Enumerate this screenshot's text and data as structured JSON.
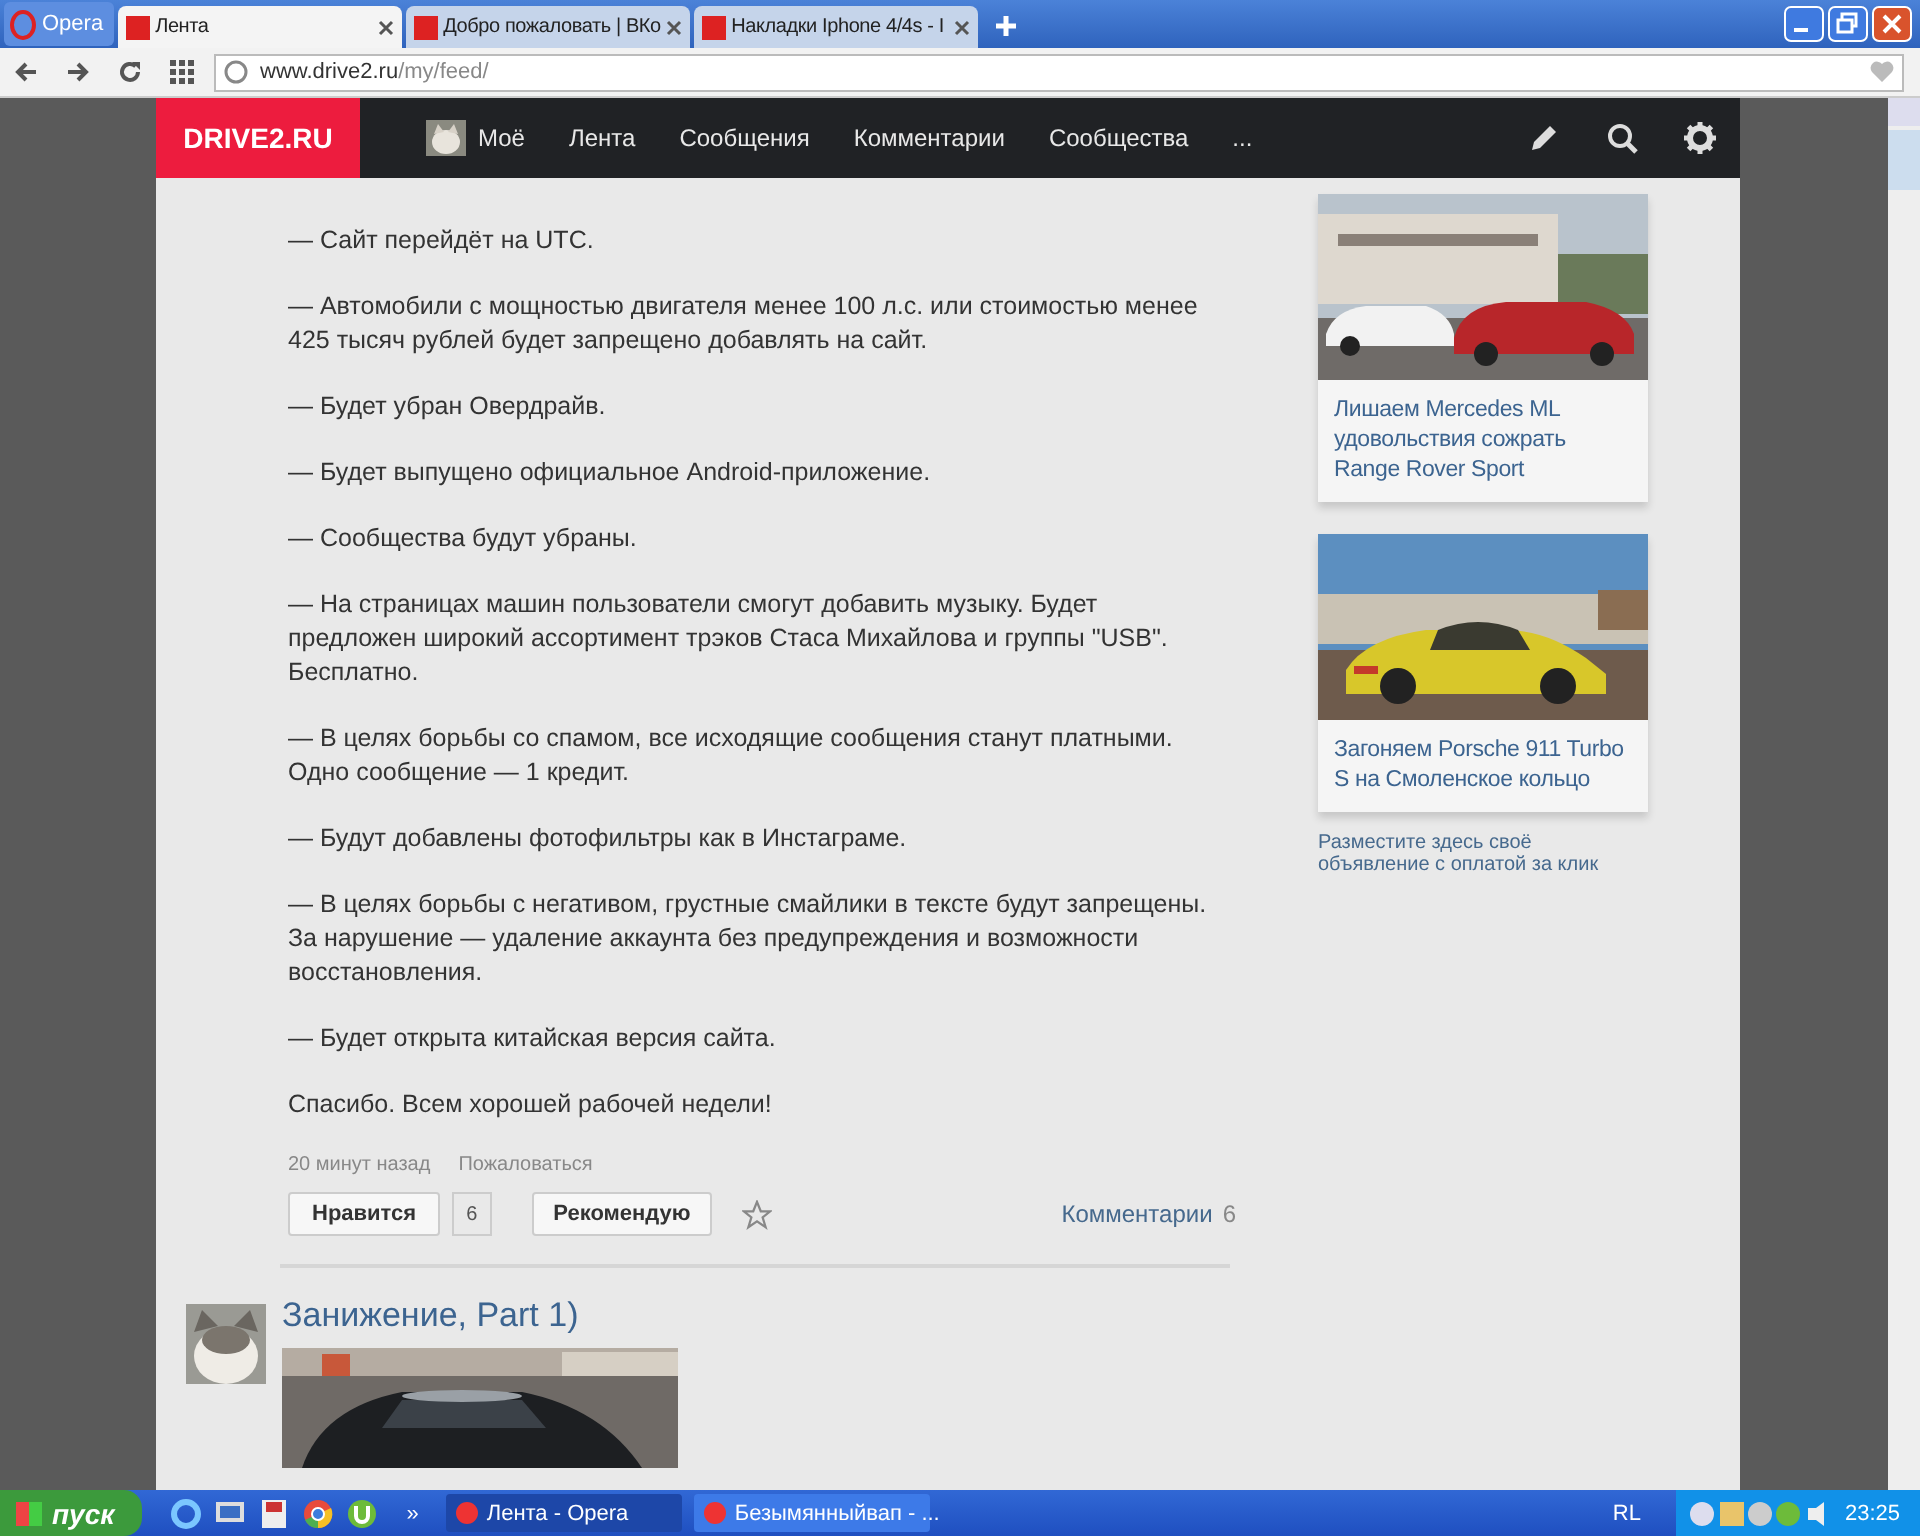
{
  "browser": {
    "menu_label": "Opera",
    "tabs": [
      {
        "title": "Лента",
        "selected": true
      },
      {
        "title": "Добро пожаловать | ВКо",
        "selected": false
      },
      {
        "title": "Накладки Iphone 4/4s - I",
        "selected": false
      }
    ],
    "address_host": "www.drive2.ru",
    "address_path": "/my/feed/"
  },
  "nav": {
    "logo": "DRIVE2.RU",
    "items": [
      {
        "label": "Моё",
        "kind": "avatar"
      },
      {
        "label": "Лента",
        "kind": "text"
      },
      {
        "label": "Сообщения",
        "kind": "text"
      },
      {
        "label": "Комментарии",
        "kind": "text"
      },
      {
        "label": "Сообщества",
        "kind": "text"
      },
      {
        "label": "...",
        "kind": "text"
      }
    ]
  },
  "post": {
    "paragraphs": [
      "— Сайт перейдёт на UTC.",
      "— Автомобили с мощностью двигателя менее 100 л.с. или стоимостью менее 425 тысяч рублей будет запрещено добавлять на сайт.",
      "— Будет убран Овердрайв.",
      "— Будет выпущено официальное Android-приложение.",
      "— Сообщества будут убраны.",
      "— На страницах машин пользователи смогут добавить музыку. Будет предложен широкий ассортимент трэков Стаса Михайлова и группы \"USB\". Бесплатно.",
      "— В целях борьбы со спамом, все исходящие сообщения станут платными. Одно сообщение — 1 кредит.",
      "— Будут добавлены фотофильтры как в Инстаграме.",
      "— В целях борьбы с негативом, грустные смайлики в тексте будут запрещены. За нарушение — удаление аккаунта без предупреждения и возможности восстановления.",
      "— Будет открыта китайская версия сайта.",
      "Спасибо. Всем хорошей рабочей недели!"
    ],
    "time": "20 минут назад",
    "report": "Пожаловаться",
    "like_label": "Нравится",
    "like_count": "6",
    "recommend_label": "Рекомендую",
    "comments_label": "Комментарии",
    "comments_count": "6"
  },
  "next_post": {
    "title": "Занижение, Part 1)"
  },
  "sidebar": {
    "ads": [
      {
        "caption": "Лишаем Mercedes ML удовольствия сожрать Range Rover Sport",
        "kind": "picture"
      },
      {
        "caption": "Загоняем Porsche 911 Turbo S на Смоленское кольцо",
        "kind": "picture"
      }
    ],
    "promo": "Разместите здесь своё объявление с оплатой за клик"
  },
  "taskbar": {
    "start": "пуск",
    "more": "»",
    "tasks": [
      {
        "label": "Лента - Opera",
        "selected": true
      },
      {
        "label": "Безымянныйвап - ...",
        "selected": false
      }
    ],
    "lang": "RL",
    "clock": "23:25"
  }
}
